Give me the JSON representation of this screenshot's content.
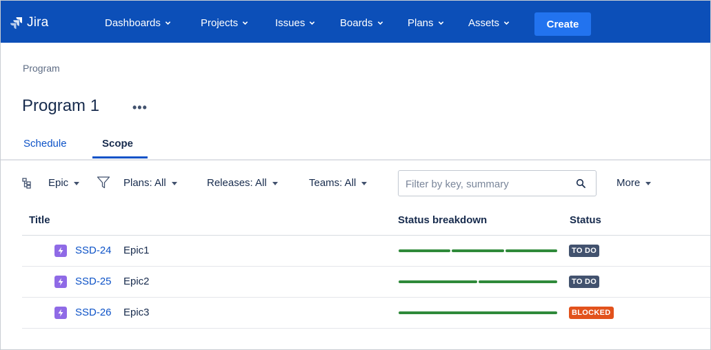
{
  "nav": {
    "logo": "Jira",
    "items": [
      {
        "label": "Dashboards"
      },
      {
        "label": "Projects"
      },
      {
        "label": "Issues"
      },
      {
        "label": "Boards"
      },
      {
        "label": "Plans"
      },
      {
        "label": "Assets"
      }
    ],
    "create_label": "Create"
  },
  "breadcrumb": "Program",
  "page": {
    "title": "Program 1",
    "more_label": "•••"
  },
  "tabs": [
    {
      "label": "Schedule",
      "active": false
    },
    {
      "label": "Scope",
      "active": true
    }
  ],
  "toolbar": {
    "hierarchy_label": "Epic",
    "plans_label": "Plans: All",
    "releases_label": "Releases: All",
    "teams_label": "Teams: All",
    "filter_placeholder": "Filter by key, summary",
    "more_label": "More"
  },
  "table": {
    "headers": {
      "title": "Title",
      "status_breakdown": "Status breakdown",
      "status": "Status"
    },
    "rows": [
      {
        "key": "SSD-24",
        "summary": "Epic1",
        "status": "TO DO",
        "status_color": "#42526e",
        "breakdown_segments": 3
      },
      {
        "key": "SSD-25",
        "summary": "Epic2",
        "status": "TO DO",
        "status_color": "#42526e",
        "breakdown_segments": 2
      },
      {
        "key": "SSD-26",
        "summary": "Epic3",
        "status": "BLOCKED",
        "status_color": "#e2521c",
        "breakdown_segments": 1
      }
    ]
  },
  "colors": {
    "nav_bg": "#0c4fb8",
    "create_bg": "#2273ef",
    "link": "#0c52c7",
    "epic": "#8f6ae6",
    "done_bar": "#2f8a3a"
  }
}
